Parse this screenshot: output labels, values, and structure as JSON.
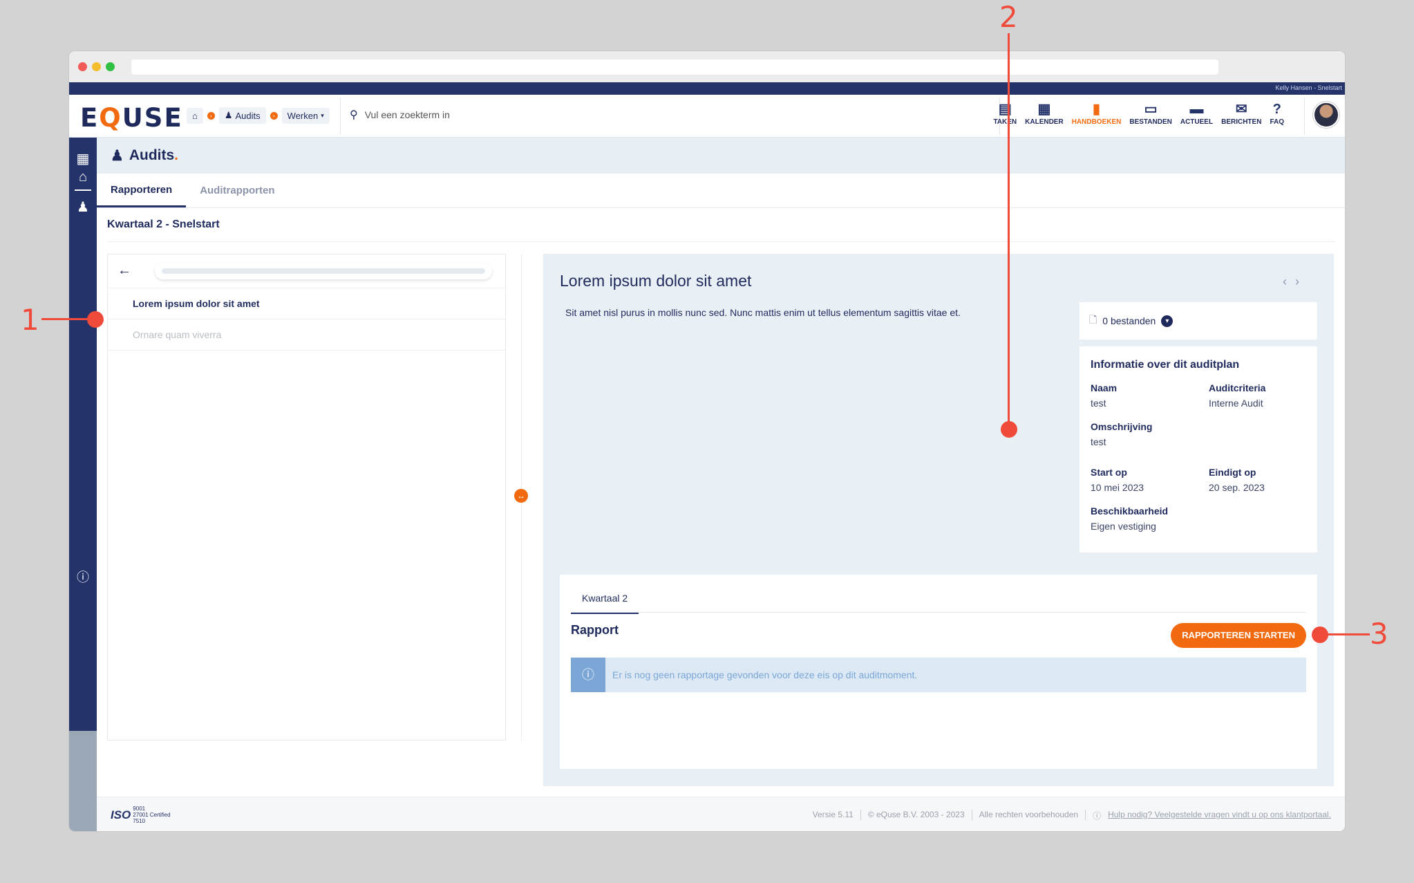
{
  "topstrip": {
    "user": "Kelly Hansen - Snelstart"
  },
  "logo": {
    "pre": "E",
    "q": "Q",
    "post": "USE"
  },
  "breadcrumbs": {
    "module": "Audits",
    "dropdown": "Werken"
  },
  "search": {
    "placeholder": "Vul een zoekterm in"
  },
  "topnav": [
    {
      "label": "TAKEN",
      "icon": "clipboard-icon"
    },
    {
      "label": "KALENDER",
      "icon": "calendar-icon"
    },
    {
      "label": "HANDBOEKEN",
      "icon": "book-icon",
      "active": true
    },
    {
      "label": "BESTANDEN",
      "icon": "archive-icon"
    },
    {
      "label": "ACTUEEL",
      "icon": "newspaper-icon"
    },
    {
      "label": "BERICHTEN",
      "icon": "chat-icon"
    },
    {
      "label": "FAQ",
      "icon": "question-icon"
    }
  ],
  "page": {
    "title": "Audits",
    "title_accent": "."
  },
  "tabs": {
    "rapporteren": "Rapporteren",
    "auditrapporten": "Auditrapporten"
  },
  "subtitle": "Kwartaal 2 - Snelstart",
  "list": {
    "items": [
      {
        "label": "Lorem ipsum dolor sit amet"
      },
      {
        "label": "Ornare quam viverra"
      }
    ]
  },
  "detail": {
    "title": "Lorem ipsum dolor sit amet",
    "description": "Sit amet nisl purus in mollis nunc sed. Nunc mattis enim ut tellus elementum sagittis vitae et.",
    "files": "0 bestanden",
    "info": {
      "heading": "Informatie over dit auditplan",
      "naam_label": "Naam",
      "naam": "test",
      "criteria_label": "Auditcriteria",
      "criteria": "Interne Audit",
      "omschrijving_label": "Omschrijving",
      "omschrijving": "test",
      "start_label": "Start op",
      "start": "10 mei 2023",
      "eind_label": "Eindigt op",
      "eind": "20 sep. 2023",
      "beschikbaarheid_label": "Beschikbaarheid",
      "beschikbaarheid": "Eigen vestiging"
    }
  },
  "report": {
    "tab": "Kwartaal 2",
    "title": "Rapport",
    "button": "RAPPORTEREN STARTEN",
    "alert": "Er is nog geen rapportage gevonden voor deze eis op dit auditmoment."
  },
  "footer": {
    "iso_big": "ISO",
    "iso_1": "9001",
    "iso_2": "27001 Certified",
    "iso_3": "7510",
    "version": "Versie 5.11",
    "copyright": "© eQuse B.V. 2003 - 2023",
    "rights": "Alle rechten voorbehouden",
    "help": "Hulp nodig? Veelgestelde vragen vindt u op ons klantportaal."
  },
  "annotations": {
    "one": "1",
    "two": "2",
    "three": "3"
  },
  "colors": {
    "navy": "#243369",
    "orange": "#f26a0f",
    "annotation": "#f04a3a"
  }
}
